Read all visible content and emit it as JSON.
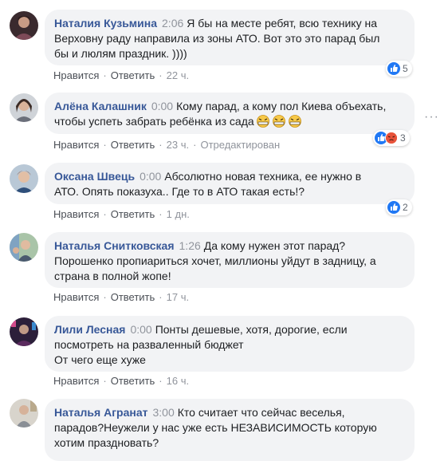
{
  "action_labels": {
    "like": "Нравится",
    "reply": "Ответить",
    "edited": "Отредактирован"
  },
  "more_icon": "ellipsis-icon",
  "comments": [
    {
      "author": "Наталия Кузьмина",
      "timestamp": "2:06",
      "text": "Я бы на месте ребят, всю технику на\nВерховну раду направила из зоны АТО. Вот это это парад был\nбы и люлям праздник. ))))",
      "age": "22 ч.",
      "reaction_count": "5",
      "reaction_icons": [
        "like-icon"
      ]
    },
    {
      "author": "Алёна Калашник",
      "timestamp": "0:00",
      "text": "Кому парад, а кому пол Киева объехать,\nчтобы успеть забрать ребёнка из сада",
      "emojis": [
        "angry-face-emoji",
        "angry-face-emoji",
        "angry-face-emoji"
      ],
      "age": "23 ч.",
      "reaction_count": "3",
      "reaction_icons": [
        "like-icon",
        "angry-icon"
      ]
    },
    {
      "author": "Оксана Швець",
      "timestamp": "0:00",
      "text": "Абсолютно новая техника, ее нужно в\nАТО. Опять показуха.. Где то в АТО такая есть!?",
      "age": "1 дн.",
      "reaction_count": "2",
      "reaction_icons": [
        "like-icon"
      ]
    },
    {
      "author": "Наталья Снитковская",
      "timestamp": "1:26",
      "text": "Да кому нужен этот парад?\nПорошенко пропиариться хочет, миллионы уйдут в задницу, а\nстрана в полной жопе!",
      "age": "17 ч."
    },
    {
      "author": "Лили Лесная",
      "timestamp": "0:00",
      "text": "Понты дешевые, хотя, дорогие, если\nпосмотреть на разваленный бюджет\nОт чего еще хуже",
      "age": "16 ч."
    },
    {
      "author": "Наталья Агранат",
      "timestamp": "3:00",
      "text": "Кто считает что сейчас веселья,\nпарадов?Неужели у нас уже есть НЕЗАВИСИМОСТЬ которую\nхотим праздновать?",
      "age": ""
    }
  ]
}
